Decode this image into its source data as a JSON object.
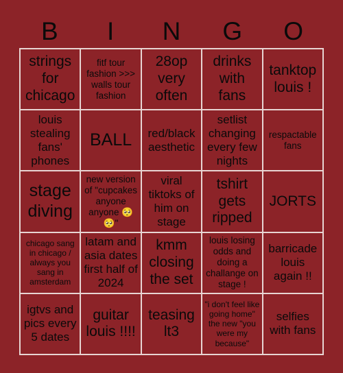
{
  "card": {
    "title_letters": [
      "B",
      "I",
      "N",
      "G",
      "O"
    ],
    "background_color": "#8c2328",
    "grid_line_color": "#e8d5d3",
    "text_color": "#0a0a0a",
    "rows": 5,
    "columns": 5,
    "cells": [
      {
        "text": "strings for chicago",
        "size": "fs-lg"
      },
      {
        "text": "fitf tour fashion >>> walls tour fashion",
        "size": "fs-sm"
      },
      {
        "text": "28op very often",
        "size": "fs-lg"
      },
      {
        "text": "drinks with fans",
        "size": "fs-lg"
      },
      {
        "text": "tanktop louis !",
        "size": "fs-lg"
      },
      {
        "text": "louis stealing fans' phones",
        "size": "fs-md"
      },
      {
        "text": "BALL",
        "size": "fs-xl"
      },
      {
        "text": "red/black aesthetic",
        "size": "fs-md"
      },
      {
        "text": "setlist changing every few nights",
        "size": "fs-md"
      },
      {
        "text": "respactable fans",
        "size": "fs-sm"
      },
      {
        "text": "stage diving",
        "size": "fs-xl"
      },
      {
        "text": "new version of \"cupcakes anyone anyone 🥺🥺\"",
        "size": "fs-sm"
      },
      {
        "text": "viral tiktoks of him on stage",
        "size": "fs-md"
      },
      {
        "text": "tshirt gets ripped",
        "size": "fs-lg"
      },
      {
        "text": "JORTS",
        "size": "fs-lg"
      },
      {
        "text": "chicago sang in chicago / always you sang in amsterdam",
        "size": "fs-xs"
      },
      {
        "text": "latam and asia dates first half of 2024",
        "size": "fs-md"
      },
      {
        "text": "kmm closing the set",
        "size": "fs-lg"
      },
      {
        "text": "louis losing odds and doing a challange on stage !",
        "size": "fs-sm"
      },
      {
        "text": "barricade louis again !!",
        "size": "fs-md"
      },
      {
        "text": "igtvs and pics every 5 dates",
        "size": "fs-md"
      },
      {
        "text": "guitar louis !!!!",
        "size": "fs-lg"
      },
      {
        "text": "teasing lt3",
        "size": "fs-lg"
      },
      {
        "text": "\"i don't feel like going home\" the new \"you were my because\"",
        "size": "fs-xs"
      },
      {
        "text": "selfies with fans",
        "size": "fs-md"
      }
    ]
  }
}
